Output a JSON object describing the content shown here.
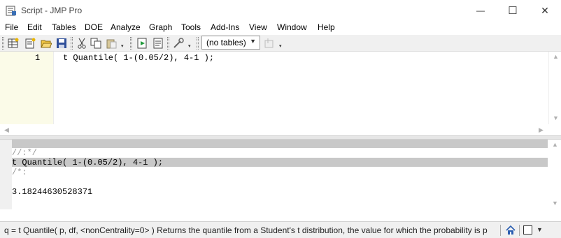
{
  "window": {
    "title": "Script - JMP Pro",
    "minimize_glyph": "—",
    "maximize_glyph": "☐",
    "close_glyph": "✕"
  },
  "menu": {
    "items": [
      "File",
      "Edit",
      "Tables",
      "DOE",
      "Analyze",
      "Graph",
      "Tools",
      "Add-Ins",
      "View",
      "Window",
      "Help"
    ]
  },
  "toolbar": {
    "table_select_value": "(no tables)",
    "icons": [
      "new-data-table-icon",
      "new-script-icon",
      "open-icon",
      "save-icon",
      "cut-icon",
      "copy-icon",
      "paste-icon",
      "run-script-icon",
      "script-index-icon",
      "tools-icon",
      "table-action-icon"
    ]
  },
  "editor": {
    "line_number": "1",
    "code": "t Quantile( 1-(0.05/2), 4-1 );"
  },
  "log": {
    "line1": "//:*/",
    "line2": "t Quantile( 1-(0.05/2), 4-1 );",
    "line3": "/*:",
    "line4": "",
    "line5": "3.18244630528371"
  },
  "status": {
    "text": "q = t Quantile( p, df, <nonCentrality=0> )  Returns the quantile from a Student's t distribution, the value for which the probability is p"
  },
  "colors": {
    "gutter": "#fbfbe8",
    "log_highlight": "#c8c8c8",
    "comment": "#9a9a9a"
  }
}
